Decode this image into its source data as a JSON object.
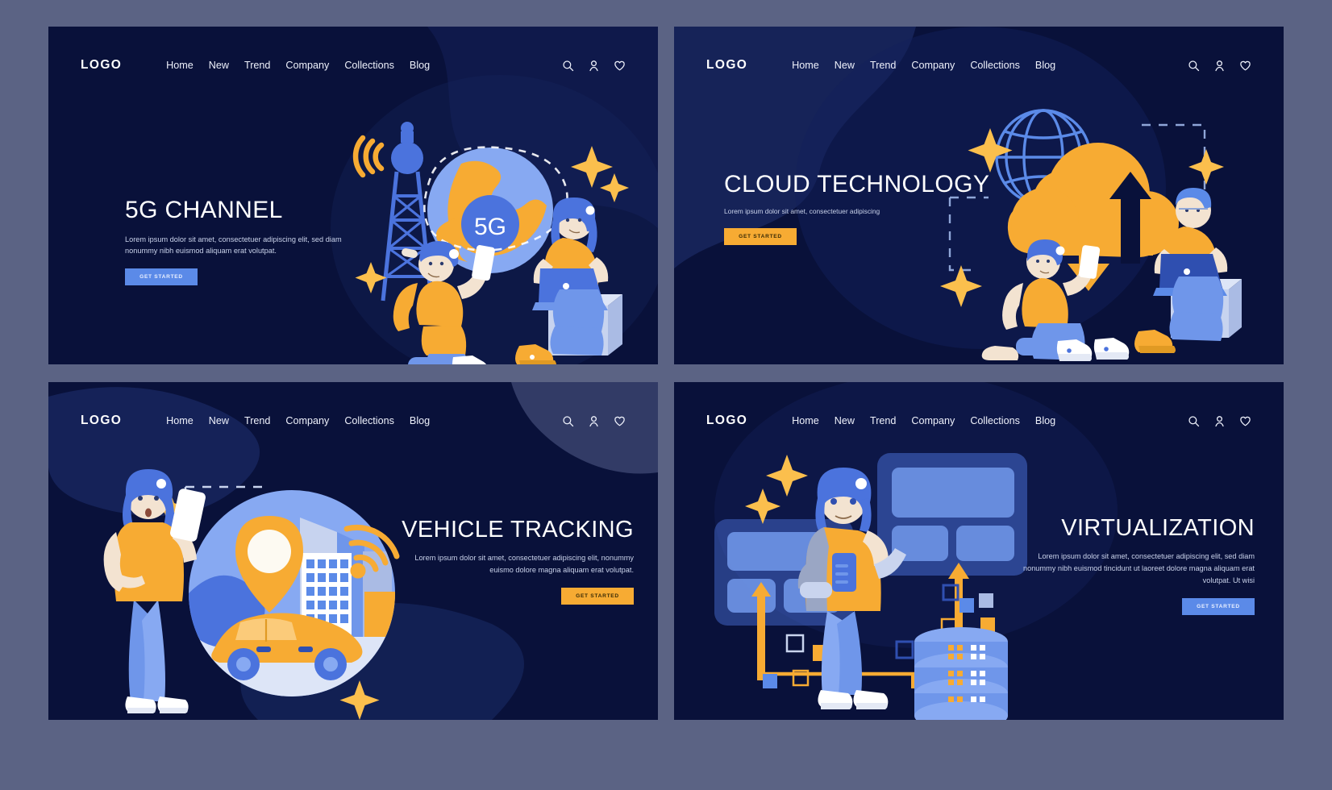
{
  "theme": {
    "page_background": "#5b6384",
    "panel_background": "#09113a",
    "accent_orange": "#f7ab33",
    "accent_blue": "#5b8ae8",
    "text_white": "#ffffff",
    "text_muted": "#c9d2ea"
  },
  "nav": {
    "logo": "LOGO",
    "items": [
      "Home",
      "New",
      "Trend",
      "Company",
      "Collections",
      "Blog"
    ],
    "icons": [
      "search-icon",
      "user-icon",
      "heart-icon"
    ]
  },
  "panels": [
    {
      "id": "5g",
      "title": "5G CHANNEL",
      "body": "Lorem ipsum dolor sit amet, consectetuer adipiscing elit, sed diam nonummy nibh euismod aliquam erat volutpat.",
      "cta": "GET STARTED",
      "cta_style": "blue",
      "align": "left",
      "illustration": {
        "name": "5g-channel-illustration",
        "badge": "5G",
        "elements": [
          "cell-tower",
          "wifi-waves",
          "globe",
          "seated-man-with-phone",
          "seated-woman-with-laptop",
          "sparkles"
        ]
      }
    },
    {
      "id": "cloud",
      "title": "CLOUD TECHNOLOGY",
      "body": "Lorem ipsum dolor sit amet, consectetuer adipiscing",
      "cta": "GET STARTED",
      "cta_style": "orange",
      "align": "left",
      "illustration": {
        "name": "cloud-technology-illustration",
        "elements": [
          "wireframe-globe",
          "orange-cloud",
          "upload-arrow",
          "download-arrow",
          "dashed-frames",
          "seated-man-with-phone",
          "seated-man-with-laptop",
          "sparkles"
        ]
      }
    },
    {
      "id": "vehicle",
      "title": "VEHICLE TRACKING",
      "body": "Lorem ipsum dolor sit amet, consectetuer adipiscing elit, nonummy euismo dolore magna aliquam erat volutpat.",
      "cta": "GET STARTED",
      "cta_style": "orange",
      "align": "right",
      "illustration": {
        "name": "vehicle-tracking-illustration",
        "elements": [
          "standing-woman-with-phone",
          "map-pin",
          "city-buildings",
          "orange-car",
          "wifi-icon",
          "dashed-frame",
          "sparkles"
        ]
      }
    },
    {
      "id": "virtual",
      "title": "VIRTUALIZATION",
      "body": "Lorem ipsum dolor sit amet, consectetuer adipiscing elit, sed diam nonummy nibh euismod tincidunt ut laoreet dolore magna aliquam erat volutpat. Ut wisi",
      "cta": "GET STARTED",
      "cta_style": "blue",
      "align": "right",
      "illustration": {
        "name": "virtualization-illustration",
        "elements": [
          "standing-person-with-tablet",
          "ui-panels",
          "database-stack",
          "orange-arrows",
          "floating-squares",
          "sparkles"
        ]
      }
    }
  ]
}
